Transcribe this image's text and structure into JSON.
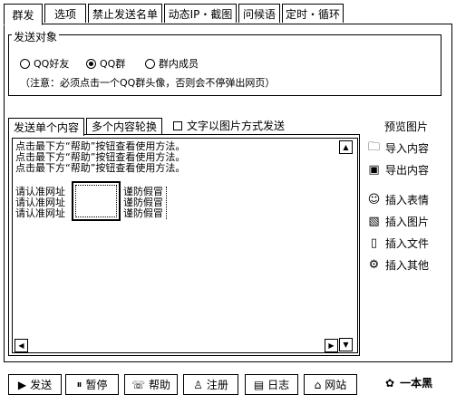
{
  "tabs": [
    {
      "label": "群发",
      "active": true
    },
    {
      "label": "选项"
    },
    {
      "label": "禁止发送名单"
    },
    {
      "label": "动态IP・截图"
    },
    {
      "label": "问候语"
    },
    {
      "label": "定时・循环"
    }
  ],
  "send_target": {
    "title": "发送对象",
    "options": [
      {
        "label": "QQ好友",
        "selected": false
      },
      {
        "label": "QQ群",
        "selected": true
      },
      {
        "label": "群内成员",
        "selected": false
      }
    ],
    "note": "（注意：必须点击一个QQ群头像，否则会不停弹出网页）"
  },
  "content_tabs": [
    {
      "label": "发送单个内容",
      "active": true
    },
    {
      "label": "多个内容轮换"
    }
  ],
  "image_mode_checkbox": {
    "label": "文字以图片方式发送",
    "checked": false
  },
  "editor": {
    "lines": [
      "点击最下方“帮助”按钮查看使用方法。",
      "点击最下方“帮助”按钮查看使用方法。",
      "点击最下方“帮助”按钮查看使用方法。"
    ],
    "left_text": [
      "请认准网址",
      "请认准网址",
      "请认准网址"
    ],
    "right_text": [
      "谨防假冒",
      "谨防假冒",
      "谨防假冒"
    ]
  },
  "side_buttons": {
    "preview": "预览图片",
    "import": "导入内容",
    "export": "导出内容",
    "emoji": "插入表情",
    "image": "插入图片",
    "file": "插入文件",
    "other": "插入其他"
  },
  "bottom_buttons": {
    "send": "发送",
    "pause": "暂停",
    "help": "帮助",
    "register": "注册",
    "log": "日志",
    "website": "网站"
  },
  "brand": "一本黑",
  "icons": [
    "send-icon",
    "pause-icon",
    "help-icon",
    "register-icon",
    "log-icon",
    "website-icon",
    "folder-icon",
    "save-icon",
    "emoji-icon",
    "image-icon",
    "file-icon",
    "other-icon",
    "brand-icon"
  ]
}
